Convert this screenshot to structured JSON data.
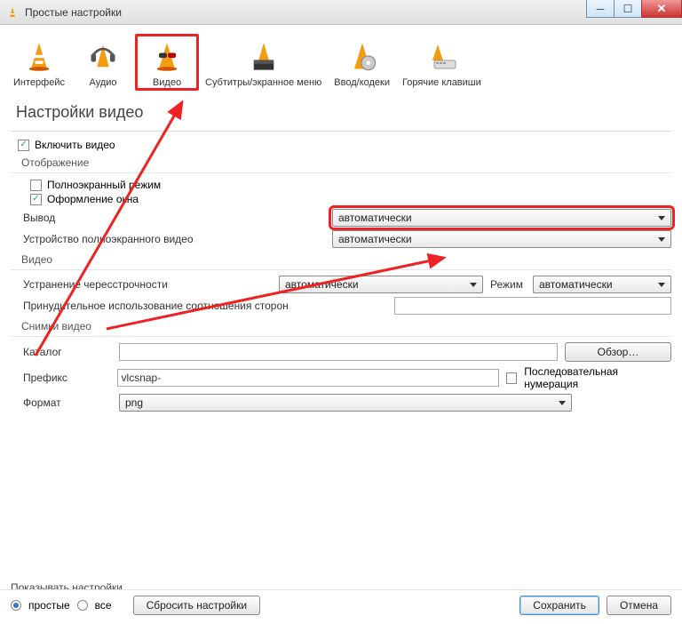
{
  "window": {
    "title": "Простые настройки"
  },
  "categories": [
    {
      "label": "Интерфейс"
    },
    {
      "label": "Аудио"
    },
    {
      "label": "Видео"
    },
    {
      "label": "Субтитры/экранное меню"
    },
    {
      "label": "Ввод/кодеки"
    },
    {
      "label": "Горячие клавиши"
    }
  ],
  "page": {
    "title": "Настройки видео"
  },
  "enable_video": {
    "label": "Включить видео",
    "checked": true
  },
  "display": {
    "header": "Отображение",
    "fullscreen": {
      "label": "Полноэкранный режим",
      "checked": false
    },
    "window_decor": {
      "label": "Оформление окна",
      "checked": true
    },
    "output_label": "Вывод",
    "output_value": "автоматически",
    "fsdev_label": "Устройство полноэкранного видео",
    "fsdev_value": "автоматически"
  },
  "video": {
    "header": "Видео",
    "deint_label": "Устранение чересстрочности",
    "deint_value": "автоматически",
    "mode_label": "Режим",
    "mode_value": "автоматически",
    "force_ar_label": "Принудительное использование соотношения сторон",
    "force_ar_value": ""
  },
  "snap": {
    "header": "Снимки видео",
    "dir_label": "Каталог",
    "dir_value": "",
    "browse": "Обзор…",
    "prefix_label": "Префикс",
    "prefix_value": "vlcsnap-",
    "seq_label": "Последовательная нумерация",
    "seq_checked": false,
    "format_label": "Формат",
    "format_value": "png"
  },
  "bottom": {
    "show_label": "Показывать настройки",
    "simple": "простые",
    "all": "все",
    "reset": "Сбросить настройки",
    "save": "Сохранить",
    "cancel": "Отмена"
  }
}
